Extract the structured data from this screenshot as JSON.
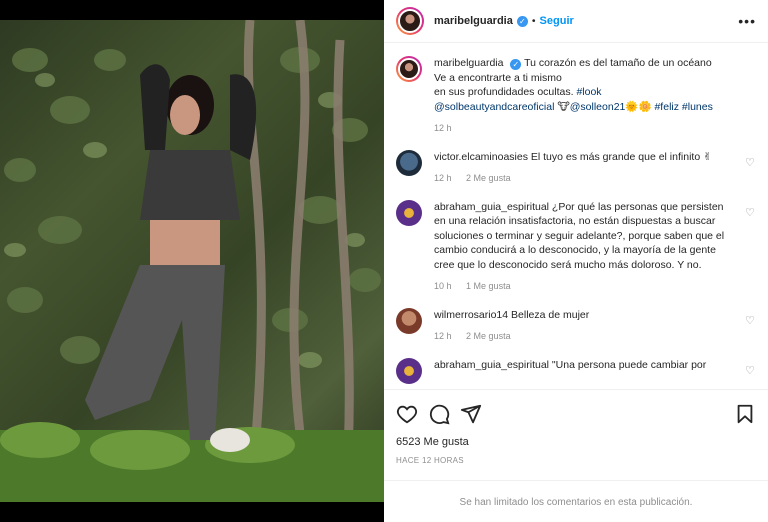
{
  "post": {
    "username": "maribelguardia",
    "follow_label": "Seguir",
    "more_icon": "more-horizontal-icon",
    "verified_icon": "verified-badge-icon"
  },
  "caption": {
    "username": "maribelguardia",
    "text_line1": "Tu corazón es del tamaño de un océano",
    "text_line2": "Ve a encontrarte a ti mismo",
    "text_line3": "en sus profundidades ocultas. ",
    "hashtag_look": "#look",
    "mention_1": "@solbeautyandcareoficial",
    "emoji_1": "🐮",
    "mention_2": "@solleon21",
    "emoji_2": "🌞🌼",
    "hashtags_end": "#feliz #lunes",
    "time": "12 h"
  },
  "comments": [
    {
      "username": "victor.elcaminoasies",
      "text": "El tuyo es más grande que el infinito ✌",
      "time": "12 h",
      "likes": "2 Me gusta"
    },
    {
      "username": "abraham_guia_espiritual",
      "text": "¿Por qué las personas que persisten en una relación insatisfactoria, no están dispuestas a buscar soluciones o terminar y seguir adelante?, porque saben que el cambio conducirá a lo desconocido, y la mayoría de la gente cree que lo desconocido será mucho más doloroso. Y no.",
      "time": "10 h",
      "likes": "1 Me gusta"
    },
    {
      "username": "wilmerrosario14",
      "text": "Belleza de mujer",
      "time": "12 h",
      "likes": "2 Me gusta"
    },
    {
      "username": "abraham_guia_espiritual",
      "text": "\"Una persona puede cambiar por",
      "time": "",
      "likes": ""
    }
  ],
  "actions": {
    "like_icon": "heart-icon",
    "comment_icon": "comment-icon",
    "share_icon": "send-icon",
    "save_icon": "bookmark-icon",
    "likes_count": "6523 Me gusta",
    "posted_ago": "HACE 12 HORAS"
  },
  "footer": {
    "limited_text": "Se han limitado los comentarios en esta publicación."
  },
  "colors": {
    "link": "#00376b",
    "follow": "#0095f6",
    "muted": "#8e8e8e",
    "border": "#efefef"
  }
}
